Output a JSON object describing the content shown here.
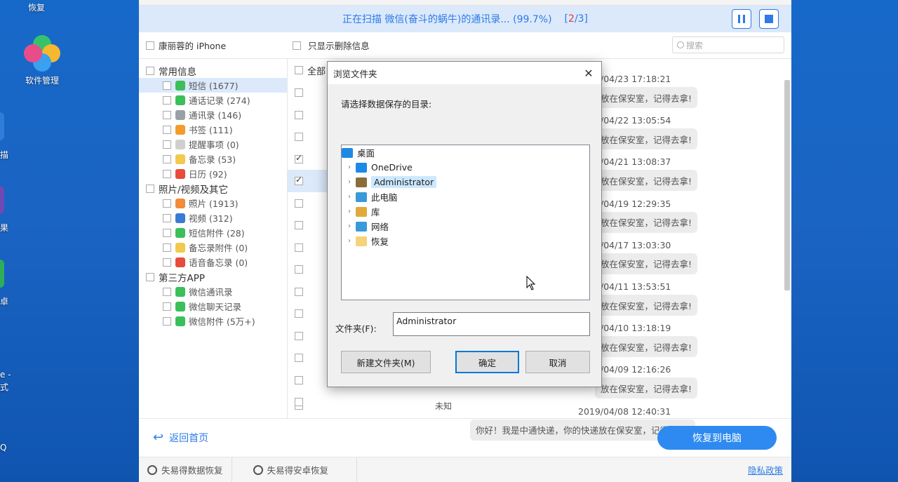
{
  "desktop": {
    "top_icon_label": "恢复",
    "app_icon_label": "软件管理",
    "edge_fragments": [
      "描",
      "果",
      "卓",
      "e -",
      "式",
      "Q"
    ]
  },
  "scan": {
    "status_text": "正在扫描 微信(奋斗的蜗牛)的通讯录... (99.7%)",
    "counter_open": "[",
    "counter_current": "2",
    "counter_total": "/3]",
    "pause_icon": "pause-icon",
    "stop_icon": "stop-icon",
    "accent_color": "#2e7be6"
  },
  "filter": {
    "device_label": "康丽蓉的 iPhone",
    "deleted_only_label": "只显示删除信息",
    "search_placeholder": "搜索"
  },
  "tree": [
    {
      "type": "cat",
      "label": "常用信息"
    },
    {
      "type": "sub",
      "label": "短信 (1677)",
      "icon": "sms-icon",
      "color": "#3cbf5a",
      "selected": true
    },
    {
      "type": "sub",
      "label": "通话记录 (274)",
      "icon": "phone-icon",
      "color": "#3cbf5a"
    },
    {
      "type": "sub",
      "label": "通讯录 (146)",
      "icon": "contacts-icon",
      "color": "#9aa0a6"
    },
    {
      "type": "sub",
      "label": "书签 (111)",
      "icon": "bookmark-icon",
      "color": "#f39c2b"
    },
    {
      "type": "sub",
      "label": "提醒事项 (0)",
      "icon": "reminder-icon",
      "color": "#cfcfcf"
    },
    {
      "type": "sub",
      "label": "备忘录 (53)",
      "icon": "notes-icon",
      "color": "#f2c94c"
    },
    {
      "type": "sub",
      "label": "日历 (92)",
      "icon": "calendar-icon",
      "color": "#e74c3c"
    },
    {
      "type": "cat",
      "label": "照片/视频及其它"
    },
    {
      "type": "sub",
      "label": "照片 (1913)",
      "icon": "photos-icon",
      "color": "#f28b3c"
    },
    {
      "type": "sub",
      "label": "视频 (312)",
      "icon": "video-icon",
      "color": "#3a7bd5"
    },
    {
      "type": "sub",
      "label": "短信附件 (28)",
      "icon": "attachment-icon",
      "color": "#3cbf5a"
    },
    {
      "type": "sub",
      "label": "备忘录附件 (0)",
      "icon": "notes-attachment-icon",
      "color": "#f2c94c"
    },
    {
      "type": "sub",
      "label": "语音备忘录 (0)",
      "icon": "voice-memo-icon",
      "color": "#e74c3c"
    },
    {
      "type": "cat",
      "label": "第三方APP"
    },
    {
      "type": "sub",
      "label": "微信通讯录",
      "icon": "wechat-icon",
      "color": "#3cbf5a"
    },
    {
      "type": "sub",
      "label": "微信聊天记录",
      "icon": "wechat-icon",
      "color": "#3cbf5a"
    },
    {
      "type": "sub",
      "label": "微信附件 (5万+)",
      "icon": "wechat-icon",
      "color": "#3cbf5a"
    }
  ],
  "list": {
    "header_label": "全部",
    "rows_checked": [
      false,
      false,
      false,
      true,
      true,
      false,
      false,
      false,
      false,
      false,
      false,
      false,
      false,
      false,
      false
    ],
    "last_label": "未知"
  },
  "chat": {
    "times": [
      "/04/23 17:18:21",
      "/04/22 13:05:54",
      "/04/21 13:08:37",
      "/04/19 12:29:35",
      "/04/17 13:03:30",
      "/04/11 13:53:51",
      "/04/10 13:18:19",
      "/04/09 12:16:26",
      "2019/04/08 12:40:31"
    ],
    "bubble_text": "放在保安室，记得去拿!",
    "last_bubble_text": "你好！我是中通快递，你的快递放在保安室，记得去拿!"
  },
  "bottom": {
    "back_label": "返回首页",
    "recover_label": "恢复到电脑",
    "status_item_1": "失易得数据恢复",
    "status_item_2": "失易得安卓恢复",
    "privacy_label": "隐私政策"
  },
  "dialog": {
    "title": "浏览文件夹",
    "prompt": "请选择数据保存的目录:",
    "tree": [
      {
        "label": "桌面",
        "icon": "desktop-icon",
        "root": true
      },
      {
        "label": "OneDrive",
        "icon": "cloud-icon"
      },
      {
        "label": "Administrator",
        "icon": "user-icon",
        "selected": true
      },
      {
        "label": "此电脑",
        "icon": "computer-icon"
      },
      {
        "label": "库",
        "icon": "library-icon"
      },
      {
        "label": "网络",
        "icon": "network-icon"
      },
      {
        "label": "恢复",
        "icon": "folder-icon"
      }
    ],
    "folder_label": "文件夹(F):",
    "folder_value": "Administrator",
    "new_folder_label": "新建文件夹(M)",
    "ok_label": "确定",
    "cancel_label": "取消"
  }
}
